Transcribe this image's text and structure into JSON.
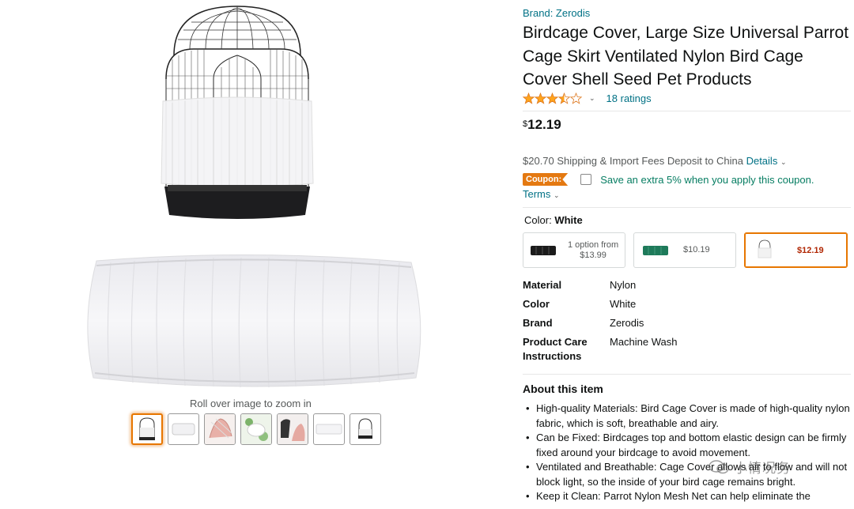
{
  "gallery": {
    "zoom_hint": "Roll over image to zoom in",
    "thumbnails": [
      "cage",
      "cover",
      "hand",
      "seeds",
      "net-hand",
      "white-cover",
      "cage-small"
    ]
  },
  "product": {
    "brand": "Brand: Zerodis",
    "title": "Birdcage Cover, Large Size Universal Parrot Cage Skirt Ventilated Nylon Bird Cage Cover Shell Seed Pet Products",
    "rating_stars": 4,
    "ratings_count": "18 ratings",
    "price_symbol": "$",
    "price_value": "12.19",
    "shipping_text": "$20.70 Shipping & Import Fees Deposit to China",
    "shipping_details": "Details",
    "coupon_badge": "Coupon:",
    "coupon_text": "Save an extra 5% when you apply this coupon.",
    "terms": "Terms",
    "color_label": "Color:",
    "color_value": "White",
    "swatches": [
      {
        "line1": "1 option from",
        "line2": "$13.99"
      },
      {
        "price": "$10.19"
      },
      {
        "price": "$12.19"
      }
    ],
    "attributes": [
      {
        "key": "Material",
        "value": "Nylon"
      },
      {
        "key": "Color",
        "value": "White"
      },
      {
        "key": "Brand",
        "value": "Zerodis"
      },
      {
        "key": "Product Care Instructions",
        "value": "Machine Wash"
      }
    ],
    "about_heading": "About this item",
    "bullets": [
      "High-quality Materials: Bird Cage Cover is made of high-quality nylon fabric, which is soft, breathable and airy.",
      "Can be Fixed: Birdcages top and bottom elastic design can be firmly fixed around your birdcage to avoid movement.",
      "Ventilated and Breathable: Cage Cover allows air to flow and will not block light, so the inside of your bird cage remains bright.",
      "Keep it Clean: Parrot Nylon Mesh Net can help eliminate the"
    ]
  },
  "watermark": "小情况务",
  "colors": {
    "link": "#007185",
    "coupon": "#e47911",
    "green": "#067D62",
    "star": "#FFA41C",
    "price_red": "#B12704"
  }
}
